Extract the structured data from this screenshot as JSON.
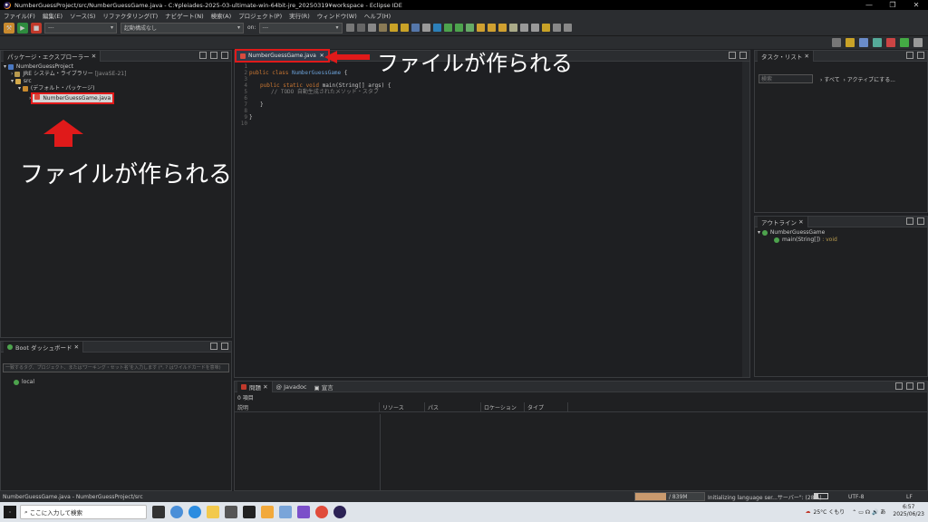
{
  "window": {
    "title": "NumberGuessProject/src/NumberGuessGame.java - C:¥pleiades-2025-03-ultimate-win-64bit-jre_20250319¥workspace - Eclipse IDE",
    "controls": [
      "—",
      "❐",
      "✕"
    ]
  },
  "menu": [
    "ファイル(F)",
    "編集(E)",
    "ソース(S)",
    "リファクタリング(T)",
    "ナビゲート(N)",
    "検索(A)",
    "プロジェクト(P)",
    "実行(R)",
    "ウィンドウ(W)",
    "ヘルプ(H)"
  ],
  "toolbar": {
    "combo1": "---",
    "combo2": "起動構成なし",
    "on_label": "on:",
    "combo3": "---"
  },
  "package_explorer": {
    "title": "パッケージ・エクスプローラー",
    "tree": {
      "project": "NumberGuessProject",
      "jre": "JRE システム・ライブラリー",
      "jre_version": "[JavaSE-21]",
      "src": "src",
      "package": "(デフォルト・パッケージ)",
      "file": "NumberGuessGame.java"
    }
  },
  "boot_dashboard": {
    "title": "Boot ダッシュボード",
    "filter_placeholder": "一致するタグ、プロジェクト、または'ワーキング・セット名'を入力します (*, ? はワイルドカードを意味)",
    "item": "local"
  },
  "editor": {
    "tab_label": "NumberGuessGame.java",
    "line_numbers": [
      "1",
      "2",
      "3",
      "4",
      "5",
      "6",
      "7",
      "8",
      "9",
      "10"
    ],
    "code": {
      "l2_kw": "public class ",
      "l2_cls": "NumberGuessGame",
      "l2_rest": " {",
      "l4_kw": "public static void ",
      "l4_rest": "main(String[] args) {",
      "l5_cmt": "// TODO 自動生成されたメソッド・スタブ",
      "l7": "}",
      "l9": "}"
    }
  },
  "annotations": {
    "editor_note": "ファイルが作られる",
    "tree_note": "ファイルが作られる"
  },
  "task_list": {
    "title": "タスク・リスト",
    "search_placeholder": "検索",
    "all_label": "すべて",
    "active_label": "アクティブにする..."
  },
  "outline": {
    "title": "アウトライン",
    "class_name": "NumberGuessGame",
    "method": "main(String[])",
    "method_type": ": void"
  },
  "problems": {
    "tabs": [
      "問題",
      "Javadoc",
      "宣言"
    ],
    "count": "0 項目",
    "columns": [
      "説明",
      "リソース",
      "パス",
      "ロケーション",
      "タイプ"
    ]
  },
  "status_bar": {
    "left": "NumberGuessGame.java - NumberGuessProject/src",
    "memory": "/ 839M",
    "progress": "Initializing language ser...サーバー\": (28%)",
    "encoding": "UTF-8",
    "line_end": "LF"
  },
  "taskbar": {
    "search_placeholder": "ここに入力して検索",
    "weather": "25°C くもり",
    "time": "6:57",
    "date": "2025/06/23"
  },
  "colors": {
    "annotation_red": "#e01a1a",
    "background": "#1e1f22"
  }
}
